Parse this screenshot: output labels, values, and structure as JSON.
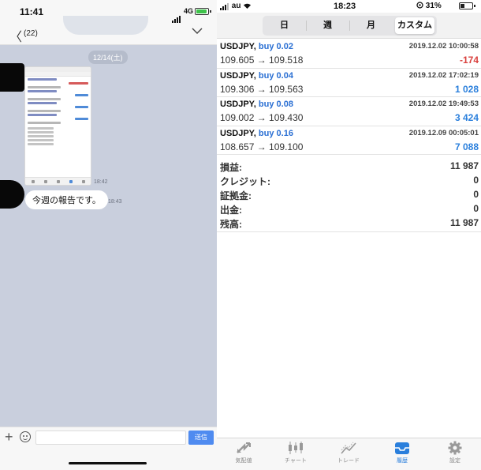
{
  "left": {
    "status": {
      "time": "11:41",
      "network": "4G"
    },
    "header": {
      "back_count": "(22)"
    },
    "date_divider": "12/14(土)",
    "image_time": "18:42",
    "message": {
      "text": "今週の報告です。",
      "time": "18:43"
    },
    "input": {
      "send_label": "送信"
    }
  },
  "right": {
    "status": {
      "carrier": "au",
      "time": "18:23",
      "battery": "31%"
    },
    "tabs": [
      {
        "label": "日",
        "active": false
      },
      {
        "label": "週",
        "active": false
      },
      {
        "label": "月",
        "active": false
      },
      {
        "label": "カスタム",
        "active": true
      }
    ],
    "trades": [
      {
        "symbol": "USDJPY,",
        "type": "buy 0.02",
        "datetime": "2019.12.02 10:00:58",
        "prices": "109.605 → 109.518",
        "profit": "-174",
        "profit_sign": "negative"
      },
      {
        "symbol": "USDJPY,",
        "type": "buy 0.04",
        "datetime": "2019.12.02 17:02:19",
        "prices": "109.306 → 109.563",
        "profit": "1 028",
        "profit_sign": "positive"
      },
      {
        "symbol": "USDJPY,",
        "type": "buy 0.08",
        "datetime": "2019.12.02 19:49:53",
        "prices": "109.002 → 109.430",
        "profit": "3 424",
        "profit_sign": "positive"
      },
      {
        "symbol": "USDJPY,",
        "type": "buy 0.16",
        "datetime": "2019.12.09 00:05:01",
        "prices": "108.657 → 109.100",
        "profit": "7 088",
        "profit_sign": "positive"
      }
    ],
    "summary": [
      {
        "label": "損益:",
        "value": "11 987"
      },
      {
        "label": "クレジット:",
        "value": "0"
      },
      {
        "label": "証拠金:",
        "value": "0"
      },
      {
        "label": "出金:",
        "value": "0"
      },
      {
        "label": "残高:",
        "value": "11 987"
      }
    ],
    "bottom_nav": [
      {
        "label": "気配値",
        "icon": "quotes-icon",
        "active": false
      },
      {
        "label": "チャート",
        "icon": "chart-icon",
        "active": false
      },
      {
        "label": "トレード",
        "icon": "trade-icon",
        "active": false
      },
      {
        "label": "履歴",
        "icon": "history-icon",
        "active": true
      },
      {
        "label": "設定",
        "icon": "gear-icon",
        "active": false
      }
    ]
  },
  "colors": {
    "positive": "#2a7fdc",
    "negative": "#d9413e",
    "accent": "#2a7fdc",
    "chat_bg": "#c9cfdd"
  }
}
